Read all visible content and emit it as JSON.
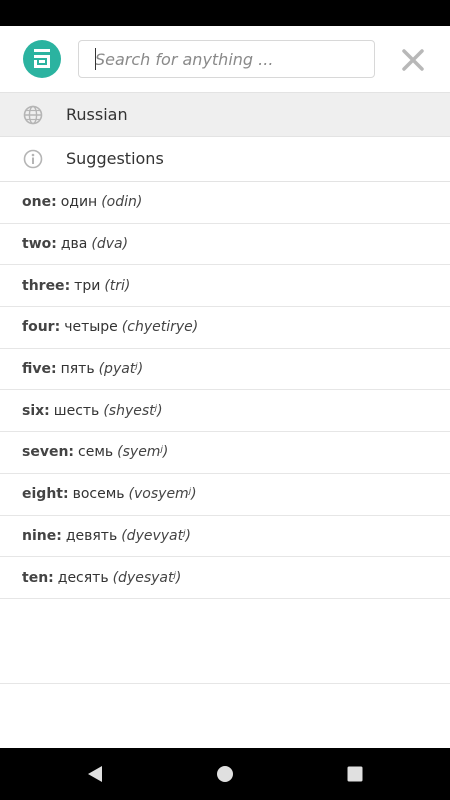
{
  "search": {
    "placeholder": "Search for anything ...",
    "value": ""
  },
  "header": {
    "logo_icon": "app-logo-icon",
    "close_icon": "close-icon"
  },
  "categories": [
    {
      "label": "Russian",
      "icon": "globe-icon"
    },
    {
      "label": "Suggestions",
      "icon": "info-icon"
    }
  ],
  "words": [
    {
      "english": "one",
      "russian": "один",
      "translit": "(odin)"
    },
    {
      "english": "two",
      "russian": "два",
      "translit": "(dva)"
    },
    {
      "english": "three",
      "russian": "три",
      "translit": "(tri)"
    },
    {
      "english": "four",
      "russian": "четыре",
      "translit": "(chyetirye)"
    },
    {
      "english": "five",
      "russian": "пять",
      "translit": "(pyatʲ)"
    },
    {
      "english": "six",
      "russian": "шесть",
      "translit": "(shyestʲ)"
    },
    {
      "english": "seven",
      "russian": "семь",
      "translit": "(syemʲ)"
    },
    {
      "english": "eight",
      "russian": "восемь",
      "translit": "(vosyemʲ)"
    },
    {
      "english": "nine",
      "russian": "девять",
      "translit": "(dyevyatʲ)"
    },
    {
      "english": "ten",
      "russian": "десять",
      "translit": "(dyesyatʲ)"
    }
  ],
  "colors": {
    "accent": "#2bb3a0",
    "selected_row_bg": "#efefef",
    "text": "#333333",
    "divider": "#e3e3e3"
  },
  "navigation": {
    "back_icon": "back-triangle-icon",
    "home_icon": "home-circle-icon",
    "recents_icon": "recents-square-icon"
  }
}
